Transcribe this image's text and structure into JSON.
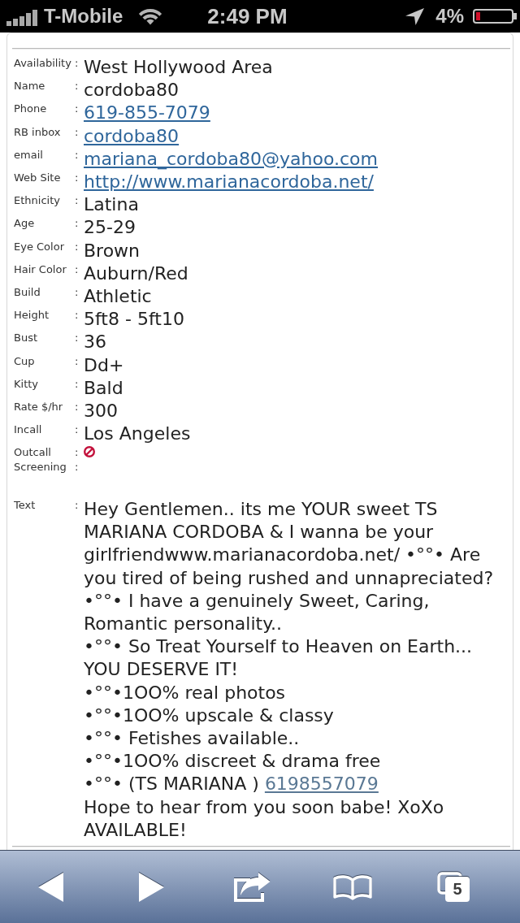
{
  "status_bar": {
    "carrier": "T-Mobile",
    "time": "2:49 PM",
    "battery": "4%"
  },
  "details": [
    {
      "label": "Availability",
      "sep": ":",
      "kind": "text",
      "value": "West Hollywood Area"
    },
    {
      "label": "Name",
      "sep": ":",
      "kind": "text",
      "value": "cordoba80"
    },
    {
      "label": "Phone",
      "sep": ":",
      "kind": "link",
      "value": "619-855-7079"
    },
    {
      "label": "RB inbox",
      "sep": ":",
      "kind": "link",
      "value": "cordoba80"
    },
    {
      "label": "email",
      "sep": ":",
      "kind": "link",
      "value": "mariana_cordoba80@yahoo.com"
    },
    {
      "label": "Web Site",
      "sep": ":",
      "kind": "link",
      "value": "http://www.marianacordoba.net/"
    },
    {
      "label": "Ethnicity",
      "sep": ":",
      "kind": "text",
      "value": "Latina"
    },
    {
      "label": "Age",
      "sep": ":",
      "kind": "text",
      "value": "25-29"
    },
    {
      "label": "Eye Color",
      "sep": ":",
      "kind": "text",
      "value": "Brown"
    },
    {
      "label": "Hair Color",
      "sep": ":",
      "kind": "text",
      "value": "Auburn/Red"
    },
    {
      "label": "Build",
      "sep": ":",
      "kind": "text",
      "value": "Athletic"
    },
    {
      "label": "Height",
      "sep": ":",
      "kind": "text",
      "value": "5ft8 - 5ft10"
    },
    {
      "label": "Bust",
      "sep": ":",
      "kind": "text",
      "value": "36"
    },
    {
      "label": "Cup",
      "sep": ":",
      "kind": "text",
      "value": "Dd+"
    },
    {
      "label": "Kitty",
      "sep": ":",
      "kind": "text",
      "value": "Bald"
    },
    {
      "label": "Rate $/hr",
      "sep": ":",
      "kind": "text",
      "value": "300"
    },
    {
      "label": "Incall",
      "sep": ":",
      "kind": "text",
      "value": "Los Angeles"
    },
    {
      "label": "Outcall",
      "sep": ":",
      "kind": "status",
      "available": false
    },
    {
      "label": "Screening",
      "sep": ":",
      "kind": "text"
    }
  ],
  "description": {
    "label": "Text",
    "sep": ":",
    "lines": [
      {
        "text": "Hey Gentlemen.. its me YOUR sweet TS"
      },
      {
        "text": "MARIANA CORDOBA & I wanna be your"
      },
      {
        "text": "girlfriendwww.marianacordoba.net/ •°°• Are"
      },
      {
        "text": "you tired of being rushed and unnapreciated?"
      },
      {
        "text": "•°°• I have a genuinely Sweet, Caring,"
      },
      {
        "text": "Romantic personality.."
      },
      {
        "text": "•°°• So Treat Yourself to Heaven on Earth..."
      },
      {
        "text": "YOU DESERVE IT!"
      },
      {
        "text": "•°°•1OO% real photos"
      },
      {
        "text": "•°°•1OO% upscale & classy"
      },
      {
        "text": "•°°• Fetishes available.."
      },
      {
        "text": "•°°•1OO% discreet & drama free"
      },
      {
        "text": "•°°• (TS MARIANA )",
        "link": "6198557079"
      },
      {
        "text": "Hope to hear from you soon babe! XoXo"
      },
      {
        "text": "AVAILABLE!"
      }
    ]
  },
  "toolbar": {
    "tab_count": "5"
  }
}
